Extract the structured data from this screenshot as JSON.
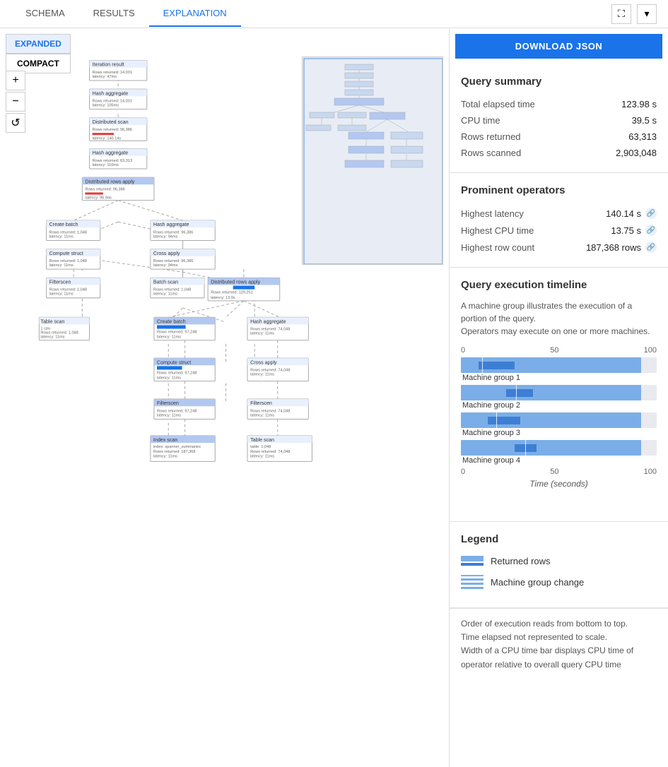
{
  "tabs": {
    "items": [
      {
        "label": "SCHEMA",
        "active": false
      },
      {
        "label": "RESULTS",
        "active": false
      },
      {
        "label": "EXPLANATION",
        "active": true
      }
    ]
  },
  "header": {
    "download_btn": "DOWNLOAD JSON"
  },
  "view_toggle": {
    "expanded": "EXPANDED",
    "compact": "COMPACT"
  },
  "query_summary": {
    "title": "Query summary",
    "rows": [
      {
        "label": "Total elapsed time",
        "value": "123.98 s"
      },
      {
        "label": "CPU time",
        "value": "39.5 s"
      },
      {
        "label": "Rows returned",
        "value": "63,313"
      },
      {
        "label": "Rows scanned",
        "value": "2,903,048"
      }
    ]
  },
  "prominent_operators": {
    "title": "Prominent operators",
    "rows": [
      {
        "label": "Highest latency",
        "value": "140.14 s",
        "link": true
      },
      {
        "label": "Highest CPU time",
        "value": "13.75 s",
        "link": true
      },
      {
        "label": "Highest row count",
        "value": "187,368 rows",
        "link": true
      }
    ]
  },
  "timeline": {
    "title": "Query execution timeline",
    "desc1": "A machine group illustrates the execution of a portion of the query.",
    "desc2": "Operators may execute on one or more machines.",
    "axis_min": "0",
    "axis_mid": "50",
    "axis_max": "100",
    "groups": [
      {
        "label": "Machine group 1",
        "fill_pct": 92,
        "inner_start": 10,
        "inner_width": 15
      },
      {
        "label": "Machine group 2",
        "fill_pct": 92,
        "inner_start": 25,
        "inner_width": 10
      },
      {
        "label": "Machine group 3",
        "fill_pct": 92,
        "inner_start": 18,
        "inner_width": 12
      },
      {
        "label": "Machine group 4",
        "fill_pct": 92,
        "inner_start": 30,
        "inner_width": 8
      }
    ],
    "x_label": "Time (seconds)"
  },
  "legend": {
    "title": "Legend",
    "items": [
      {
        "type": "bar",
        "text": "Returned rows"
      },
      {
        "type": "stripes",
        "text": "Machine group change"
      }
    ]
  },
  "footer": {
    "lines": [
      "Order of execution reads from bottom to top.",
      "Time elapsed not represented to scale.",
      "Width of a CPU time bar displays CPU time of operator relative to overall query CPU time"
    ]
  }
}
